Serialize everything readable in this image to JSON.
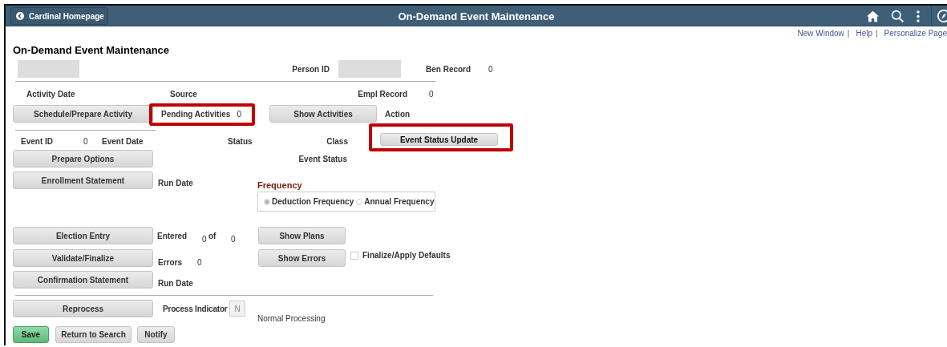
{
  "header": {
    "back_button": "Cardinal Homepage",
    "title": "On-Demand Event Maintenance"
  },
  "header_links": {
    "items": [
      "New Window",
      "Help",
      "Personalize Page"
    ],
    "separator": "|"
  },
  "page_title": "On-Demand Event Maintenance",
  "person": {
    "person_id_label": "Person ID",
    "ben_record_label": "Ben Record",
    "ben_record": "0"
  },
  "activity": {
    "activity_date_label": "Activity Date",
    "source_label": "Source",
    "empl_record_label": "Empl Record",
    "empl_record": "0",
    "schedule_button": "Schedule/Prepare Activity",
    "pending_label": "Pending Activities",
    "pending": "0",
    "pending_highlighted": true,
    "show_activities_button": "Show Activities",
    "action_label": "Action"
  },
  "event": {
    "event_id_label": "Event ID",
    "event_id": "0",
    "event_date_label": "Event Date",
    "status_label": "Status",
    "class_label": "Class",
    "status_update_button": "Event Status Update",
    "status_update_highlighted": true,
    "prepare_button": "Prepare Options",
    "event_status_label": "Event Status",
    "enrollment_button": "Enrollment Statement",
    "run_date_label": "Run Date"
  },
  "frequency": {
    "label": "Frequency",
    "options": [
      {
        "label": "Deduction Frequency",
        "selected": true
      },
      {
        "label": "Annual Frequency",
        "selected": false
      }
    ]
  },
  "election": {
    "election_button": "Election Entry",
    "entered_label": "Entered",
    "entered": "0",
    "of_label": "of",
    "of_total": "0",
    "show_plans_button": "Show Plans",
    "validate_button": "Validate/Finalize",
    "errors_label": "Errors",
    "errors": "0",
    "show_errors_button": "Show Errors",
    "finalize": {
      "label": "Finalize/Apply Defaults",
      "checked": false
    },
    "confirmation_button": "Confirmation Statement",
    "run_date_label": "Run Date"
  },
  "process": {
    "reprocess_button": "Reprocess",
    "indicator_label": "Process Indicator",
    "indicator": "N",
    "description": "Normal Processing"
  },
  "footer_buttons": [
    {
      "label": "Save",
      "kind": "primary"
    },
    {
      "label": "Return to Search",
      "kind": "secondary"
    },
    {
      "label": "Notify",
      "kind": "secondary"
    }
  ]
}
